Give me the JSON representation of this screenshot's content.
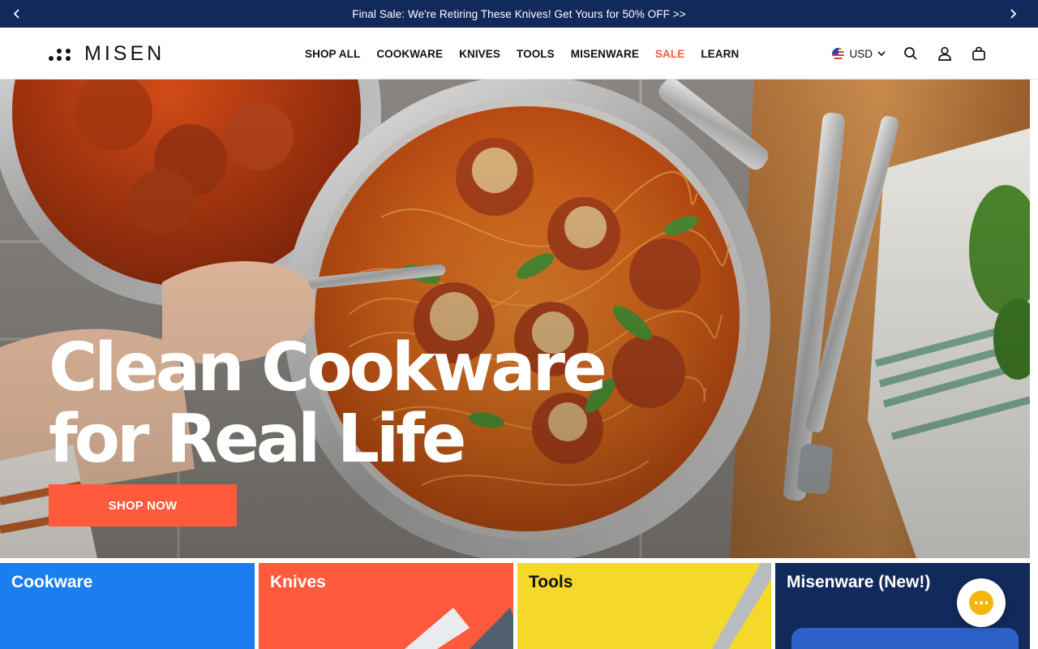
{
  "announcement": {
    "message": "Final Sale: We're Retiring These Knives! Get Yours for 50% OFF >>",
    "prev_icon": "chevron-left-icon",
    "next_icon": "chevron-right-icon"
  },
  "header": {
    "logo_text": "MISEN",
    "nav": [
      {
        "label": "SHOP ALL"
      },
      {
        "label": "COOKWARE"
      },
      {
        "label": "KNIVES"
      },
      {
        "label": "TOOLS"
      },
      {
        "label": "MISENWARE"
      },
      {
        "label": "SALE"
      },
      {
        "label": "LEARN"
      }
    ],
    "currency": "USD",
    "icons": [
      "us-flag-icon",
      "chevron-down-icon",
      "search-icon",
      "account-icon",
      "cart-icon"
    ]
  },
  "hero": {
    "title_line1": "Clean Cookware",
    "title_line2": "for Real Life",
    "cta_label": "SHOP NOW"
  },
  "tiles": [
    {
      "label": "Cookware",
      "color": "#1a7ef0"
    },
    {
      "label": "Knives",
      "color": "#ff5a3c"
    },
    {
      "label": "Tools",
      "color": "#f5d92a"
    },
    {
      "label": "Misenware (New!)",
      "color": "#12295b"
    }
  ],
  "colors": {
    "announcement_bg": "#12295b",
    "accent": "#ff5a3c",
    "chat": "#f5b50f"
  },
  "chat": {
    "icon": "chat-bubble-icon"
  }
}
